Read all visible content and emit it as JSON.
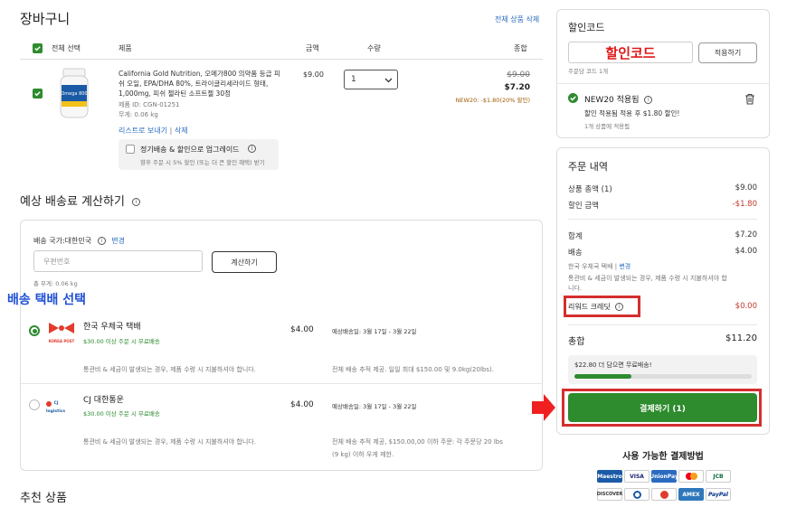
{
  "cart": {
    "title": "장바구니",
    "delete_all": "전체 상품 삭제",
    "headers": {
      "select_all": "전체 선택",
      "product": "제품",
      "amount": "금액",
      "quantity": "수량",
      "total": "종합"
    },
    "item": {
      "name": "California Gold Nutrition, 오메가800 의약품 등급 피쉬 오일, EPA/DHA 80%, 트라이글리세라이드 형태, 1,000mg, 피쉬 젤라틴 소프트젤 30정",
      "product_id": "제품 ID: CGN-01251",
      "weight": "무게: 0.06 kg",
      "price": "$9.00",
      "qty": "1",
      "original_total": "$9.00",
      "discounted_total": "$7.20",
      "discount_note": "NEW20: -$1.80(20% 할인)",
      "wishlist_link": "리스트로 보내기",
      "delete_link": "삭제",
      "upgrade_title": "정기배송 & 할인으로 업그레이드",
      "upgrade_desc": "향후 주문 시 5% 할인 (또는 더 큰 할인 혜택) 받기"
    }
  },
  "shipping": {
    "title": "예상 배송료 계산하기",
    "country_label": "배송 국가:대한민국",
    "change_link": "변경",
    "postal_placeholder": "우편번호",
    "calc_button": "계산하기",
    "total_weight": "총 무게: 0.06 kg",
    "annotation": "배송 택배 선택",
    "options": [
      {
        "name": "한국 우체국 택배",
        "free_note": "$30.00 이상 주문 시 무료배송",
        "price": "$4.00",
        "eta": "예상배송일: 3월 17일 - 3월 22일",
        "customs": "통관비 & 세금이 발생되는 경우, 제품 수령 시 지불하셔야 합니다.",
        "note": "전체 배송 추적 제공. 일일 최대 $150.00 및 9.0kg(20lbs).",
        "note2": "",
        "selected": true,
        "logo_text": "KOREA POST"
      },
      {
        "name": "CJ 대한통운",
        "free_note": "$30.00 이상 주문 시 무료배송",
        "price": "$4.00",
        "eta": "예상배송일: 3월 17일 - 3월 22일",
        "customs": "통관비 & 세금이 발생되는 경우, 제품 수령 시 지불하셔야 합니다.",
        "note": "전체 배송 추적 제공, $150.00,00 이하 주문: 각 주문당 20 lbs",
        "note2": "(9 kg) 이하 우게 제한.",
        "selected": false,
        "logo_text": "CJ logistics"
      }
    ]
  },
  "recommended": {
    "title": "추천 상품"
  },
  "coupon": {
    "title": "할인코드",
    "input_value": "할인코드",
    "apply_button": "적용하기",
    "limit_note": "주문당 코드 1개",
    "applied_code": "NEW20 적용됨",
    "applied_desc": "할인 적용됨 적용 후 $1.80 할인!",
    "applied_count": "1개 상품에 적용됨"
  },
  "summary": {
    "title": "주문 내역",
    "subtotal_label": "상품 총액 (1)",
    "subtotal": "$9.00",
    "discount_label": "할인 금액",
    "discount": "-$1.80",
    "total_label": "합계",
    "total": "$7.20",
    "shipping_label": "배송",
    "shipping": "$4.00",
    "carrier": "한국 우체국 택배",
    "carrier_change": "변경",
    "customs_note": "통관비 & 세금이 발생되는 경우, 제품 수령 시 지불하셔야 합니다.",
    "rewards_label": "리워드 크레딧",
    "rewards": "$0.00",
    "grand_label": "총합",
    "grand_total": "$11.20",
    "free_ship_msg": "$22.80 더 담으면 무료배송!",
    "free_ship_progress": 0.32,
    "checkout_button": "결제하기 (1)"
  },
  "payment": {
    "title": "사용 가능한 결제방법",
    "methods": [
      "Maestro",
      "VISA",
      "UnionPay",
      "MasterCard",
      "JCB",
      "DISCOVER",
      "Diners",
      "Card",
      "AMEX",
      "PayPal"
    ]
  },
  "colors": {
    "accent_green": "#2e8b2e",
    "highlight_red": "#d32f2f",
    "annotation_blue": "#1f4fd6",
    "discount_red": "#c0392b"
  }
}
